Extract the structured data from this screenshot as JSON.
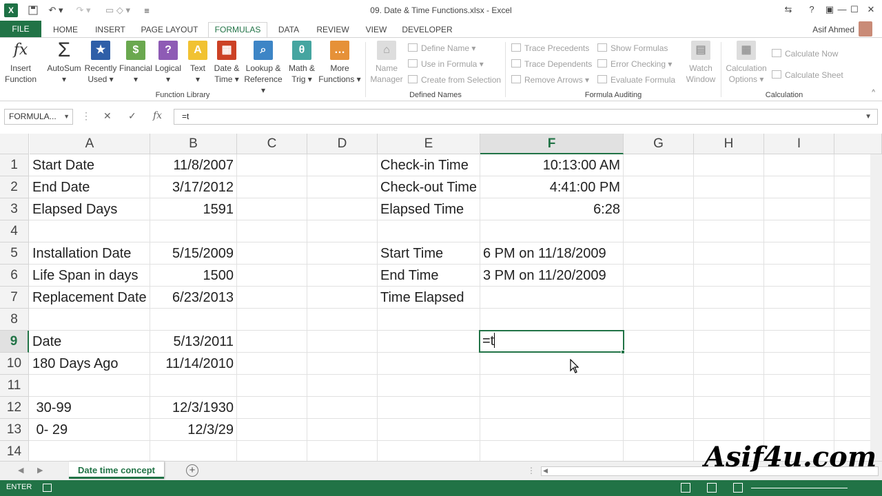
{
  "app": {
    "window_title": "09. Date & Time Functions.xlsx - Excel",
    "logo_letter": "X",
    "user_name": "Asif Ahmed"
  },
  "tabs": [
    "FILE",
    "HOME",
    "INSERT",
    "PAGE LAYOUT",
    "FORMULAS",
    "DATA",
    "REVIEW",
    "VIEW",
    "DEVELOPER"
  ],
  "active_tab": "FORMULAS",
  "ribbon": {
    "insert_function": {
      "line1": "Insert",
      "line2": "Function"
    },
    "autosum": {
      "line1": "AutoSum",
      "line2": "▾"
    },
    "recently_used": {
      "line1": "Recently",
      "line2": "Used ▾"
    },
    "financial": {
      "line1": "Financial",
      "line2": "▾"
    },
    "logical": {
      "line1": "Logical",
      "line2": "▾"
    },
    "text": {
      "line1": "Text",
      "line2": "▾"
    },
    "date_time": {
      "line1": "Date &",
      "line2": "Time ▾"
    },
    "lookup_reference": {
      "line1": "Lookup &",
      "line2": "Reference ▾"
    },
    "math_trig": {
      "line1": "Math &",
      "line2": "Trig ▾"
    },
    "more_functions": {
      "line1": "More",
      "line2": "Functions ▾"
    },
    "function_library_label": "Function Library",
    "name_manager": {
      "line1": "Name",
      "line2": "Manager"
    },
    "define_name": "Define Name ▾",
    "use_in_formula": "Use in Formula ▾",
    "create_from_selection": "Create from Selection",
    "defined_names_label": "Defined Names",
    "trace_precedents": "Trace Precedents",
    "trace_dependents": "Trace Dependents",
    "remove_arrows": "Remove Arrows ▾",
    "show_formulas": "Show Formulas",
    "error_checking": "Error Checking ▾",
    "evaluate_formula": "Evaluate Formula",
    "watch_window": {
      "line1": "Watch",
      "line2": "Window"
    },
    "formula_auditing_label": "Formula Auditing",
    "calculation_options": {
      "line1": "Calculation",
      "line2": "Options ▾"
    },
    "calculate_now": "Calculate Now",
    "calculate_sheet": "Calculate Sheet",
    "calculation_label": "Calculation"
  },
  "formula_bar": {
    "name_box": "FORMULA...",
    "cancel": "✕",
    "enter": "✓",
    "fx": "fx",
    "value": "=t"
  },
  "columns": [
    "A",
    "B",
    "C",
    "D",
    "E",
    "F",
    "G",
    "H",
    "I"
  ],
  "selected_column": "F",
  "rows": [
    "1",
    "2",
    "3",
    "4",
    "5",
    "6",
    "7",
    "8",
    "9",
    "10",
    "11",
    "12",
    "13",
    "14"
  ],
  "selected_row": "9",
  "cells": {
    "A1": "Start Date",
    "B1": "11/8/2007",
    "A2": "End Date",
    "B2": "3/17/2012",
    "A3": "Elapsed Days",
    "B3": "1591",
    "A5": "Installation Date",
    "B5": "5/15/2009",
    "A6": "Life Span in days",
    "B6": "1500",
    "A7": "Replacement Date",
    "B7": "6/23/2013",
    "A9": "Date",
    "B9": "5/13/2011",
    "A10": "180 Days Ago",
    "B10": "11/14/2010",
    "A12": " 30-99",
    "B12": "12/3/1930",
    "A13": " 0- 29",
    "B13": "12/3/29",
    "E1": "Check-in Time",
    "F1": "10:13:00 AM",
    "E2": "Check-out Time",
    "F2": "4:41:00 PM",
    "E3": "Elapsed Time",
    "F3": "6:28",
    "E5": "Start Time",
    "F5": "6 PM on 11/18/2009",
    "E6": "End Time",
    "F6": "3 PM on 11/20/2009",
    "E7": "Time Elapsed",
    "F9": "=t"
  },
  "sheet_tab": "Date time concept",
  "status_mode": "ENTER",
  "watermark": "Asif4u.com",
  "colors": {
    "accent": "#217346"
  }
}
